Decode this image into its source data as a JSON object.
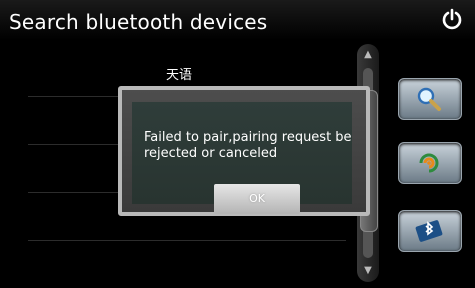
{
  "header": {
    "title": "Search bluetooth devices"
  },
  "devices": [
    {
      "name": "天语"
    }
  ],
  "dialog": {
    "message": "Failed to pair,pairing request be rejected or canceled",
    "ok_label": "OK"
  },
  "icons": {
    "power": "power-icon",
    "search": "search-icon",
    "pair": "pair-icon",
    "bluetooth": "bluetooth-icon",
    "scroll_up": "scroll-up-icon",
    "scroll_down": "scroll-down-icon"
  },
  "colors": {
    "background": "#000000",
    "button": "#9aa5ae",
    "dialog": "#3a3a3a"
  }
}
